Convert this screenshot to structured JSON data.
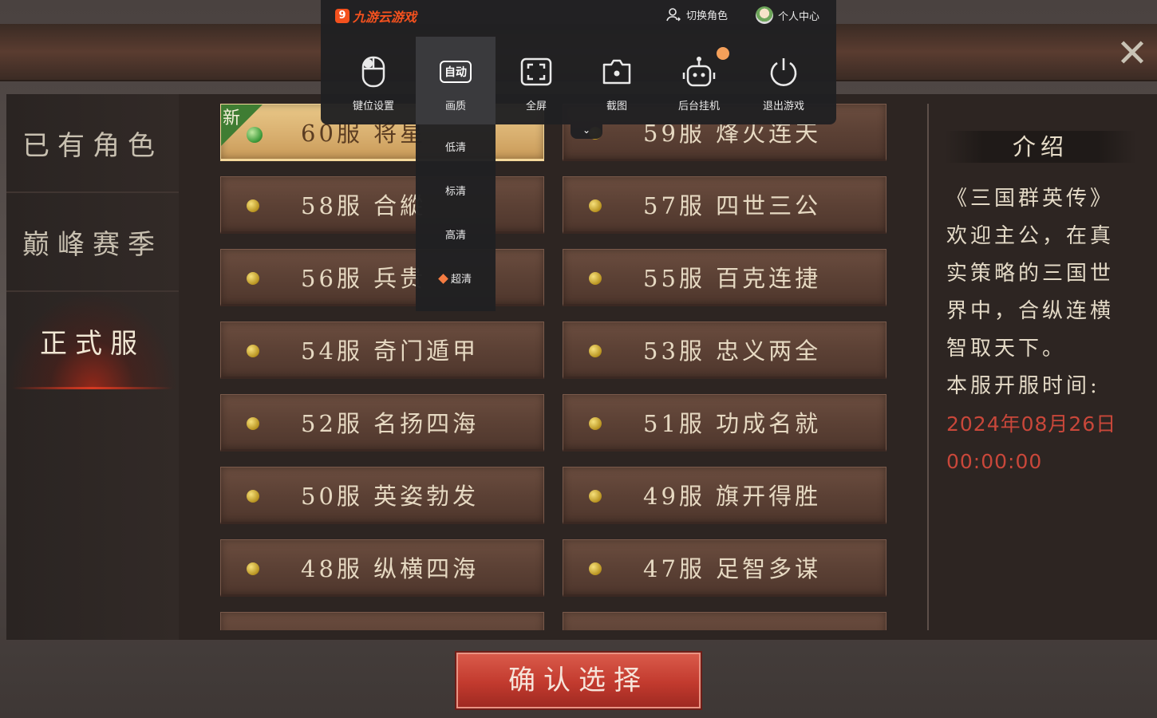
{
  "colors": {
    "accent": "#f4511e",
    "time_red": "#c9473a",
    "selected_server": "#d9b070"
  },
  "game": {
    "tabs": [
      {
        "label": "已有角色",
        "active": false
      },
      {
        "label": "巅峰赛季",
        "active": false
      },
      {
        "label": "正式服",
        "active": true
      }
    ],
    "new_badge": "新",
    "servers": [
      {
        "name": "60服 将星",
        "selected": true,
        "new": true
      },
      {
        "name": "59服 烽火连天",
        "selected": false
      },
      {
        "name": "58服 合縱",
        "selected": false
      },
      {
        "name": "57服 四世三公",
        "selected": false
      },
      {
        "name": "56服 兵贵",
        "selected": false
      },
      {
        "name": "55服 百克连捷",
        "selected": false
      },
      {
        "name": "54服 奇门遁甲",
        "selected": false
      },
      {
        "name": "53服 忠义两全",
        "selected": false
      },
      {
        "name": "52服 名扬四海",
        "selected": false
      },
      {
        "name": "51服 功成名就",
        "selected": false
      },
      {
        "name": "50服 英姿勃发",
        "selected": false
      },
      {
        "name": "49服 旗开得胜",
        "selected": false
      },
      {
        "name": "48服 纵横四海",
        "selected": false
      },
      {
        "name": "47服 足智多谋",
        "selected": false
      }
    ],
    "intro": {
      "title": "介绍",
      "lines": [
        "《三国群英传》",
        "欢迎主公，在真",
        "实策略的三国世",
        "界中，合纵连横",
        "智取天下。",
        "本服开服时间:"
      ],
      "date": "2024年08月26日",
      "time": "00:00:00"
    },
    "confirm_label": "确认选择",
    "close_icon": "close-x-icon"
  },
  "overlay": {
    "brand": "九游云游戏",
    "switch_role": "切换角色",
    "user_center": "个人中心",
    "tools": [
      {
        "label": "键位设置",
        "icon": "mouse-icon"
      },
      {
        "label": "画质",
        "icon": "auto-quality-icon",
        "badge": "自动"
      },
      {
        "label": "全屏",
        "icon": "fullscreen-icon"
      },
      {
        "label": "截图",
        "icon": "camera-icon"
      },
      {
        "label": "后台挂机",
        "icon": "robot-icon"
      },
      {
        "label": "退出游戏",
        "icon": "power-icon"
      }
    ],
    "quality_options": [
      {
        "label": "低清",
        "premium": false
      },
      {
        "label": "标清",
        "premium": false
      },
      {
        "label": "高清",
        "premium": false
      },
      {
        "label": "超清",
        "premium": true
      }
    ]
  }
}
